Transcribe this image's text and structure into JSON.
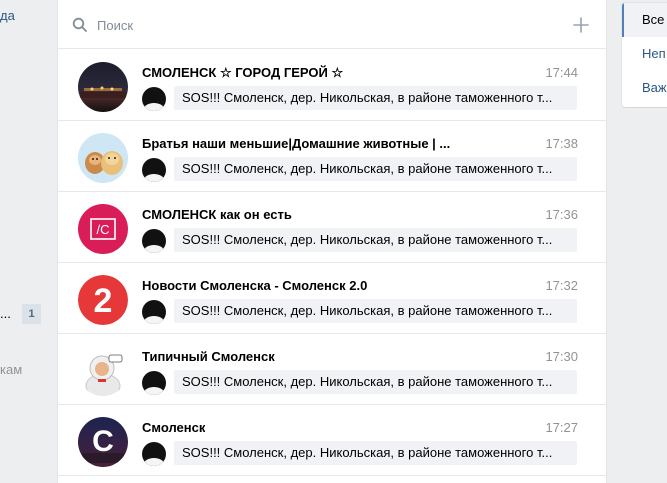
{
  "left_sidebar": {
    "fragment_1": "да",
    "fragment_2": "...",
    "counter": "1",
    "fragment_3": "кам"
  },
  "search": {
    "placeholder": "Поиск"
  },
  "colors": {
    "accent": "#5181b8",
    "link": "#2a5885",
    "preview_bg": "#f0f2f5",
    "time": "#939393"
  },
  "dialogs": [
    {
      "title": "СМОЛЕНСК ☆ ГОРОД ГЕРОЙ ☆",
      "time": "17:44",
      "preview": "SOS!!! Смоленск, дер. Никольская, в районе таможенного т..."
    },
    {
      "title": "Братья наши меньшие|Домашние животные | ...",
      "time": "17:38",
      "preview": "SOS!!! Смоленск, дер. Никольская, в районе таможенного т..."
    },
    {
      "title": "СМОЛЕНСК как он есть",
      "time": "17:36",
      "preview": "SOS!!! Смоленск, дер. Никольская, в районе таможенного т..."
    },
    {
      "title": "Новости Смоленска - Смоленск 2.0",
      "time": "17:32",
      "preview": "SOS!!! Смоленск, дер. Никольская, в районе таможенного т..."
    },
    {
      "title": "Типичный Смоленск",
      "time": "17:30",
      "preview": "SOS!!! Смоленск, дер. Никольская, в районе таможенного т..."
    },
    {
      "title": "Смоленск",
      "time": "17:27",
      "preview": "SOS!!! Смоленск, дер. Никольская, в районе таможенного т..."
    }
  ],
  "avatar_labels": {
    "slash_c": "/C",
    "two": "2",
    "letter_c": "С"
  },
  "right_menu": {
    "items": [
      "Все",
      "Неп",
      "Важ"
    ]
  }
}
